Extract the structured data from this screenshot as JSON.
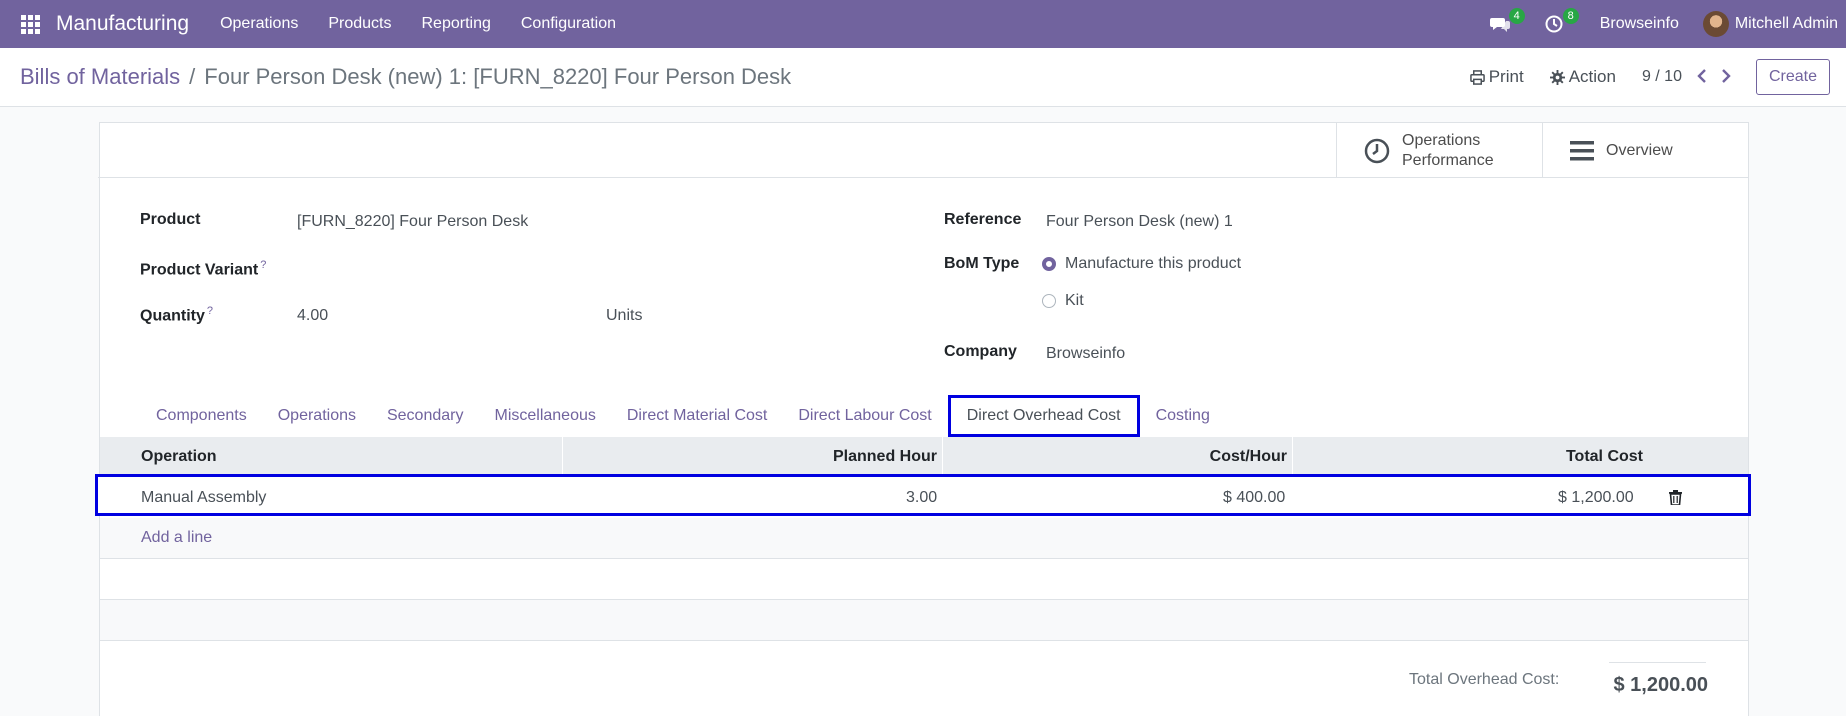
{
  "navbar": {
    "app_name": "Manufacturing",
    "menu": [
      "Operations",
      "Products",
      "Reporting",
      "Configuration"
    ],
    "messages_count": "4",
    "activities_count": "8",
    "company": "Browseinfo",
    "user": "Mitchell Admin",
    "bg_color": "#71639e"
  },
  "breadcrumb": {
    "parent": "Bills of Materials",
    "separator": "/",
    "current": "Four Person Desk (new) 1: [FURN_8220] Four Person Desk"
  },
  "actions": {
    "print": "Print",
    "action": "Action",
    "pager": "9 / 10",
    "create": "Create"
  },
  "smart_buttons": {
    "operations_performance_line1": "Operations",
    "operations_performance_line2": "Performance",
    "overview": "Overview"
  },
  "form": {
    "product_label": "Product",
    "product_value": "[FURN_8220] Four Person Desk",
    "variant_label": "Product Variant",
    "quantity_label": "Quantity",
    "quantity_value": "4.00",
    "uom_value": "Units",
    "reference_label": "Reference",
    "reference_value": "Four Person Desk (new) 1",
    "bom_type_label": "BoM Type",
    "bom_type_options": [
      "Manufacture this product",
      "Kit"
    ],
    "bom_type_selected": "Manufacture this product",
    "company_label": "Company",
    "company_value": "Browseinfo",
    "help_mark": "?"
  },
  "tabs": [
    "Components",
    "Operations",
    "Secondary",
    "Miscellaneous",
    "Direct Material Cost",
    "Direct Labour Cost",
    "Direct Overhead Cost",
    "Costing"
  ],
  "active_tab": "Direct Overhead Cost",
  "table": {
    "headers": [
      "Operation",
      "Planned Hour",
      "Cost/Hour",
      "Total Cost"
    ],
    "rows": [
      {
        "operation": "Manual Assembly",
        "planned_hour": "3.00",
        "cost_hour": "$ 400.00",
        "total_cost": "$ 1,200.00"
      }
    ],
    "add_line": "Add a line"
  },
  "totals": {
    "label": "Total Overhead Cost:",
    "value": "$ 1,200.00"
  }
}
